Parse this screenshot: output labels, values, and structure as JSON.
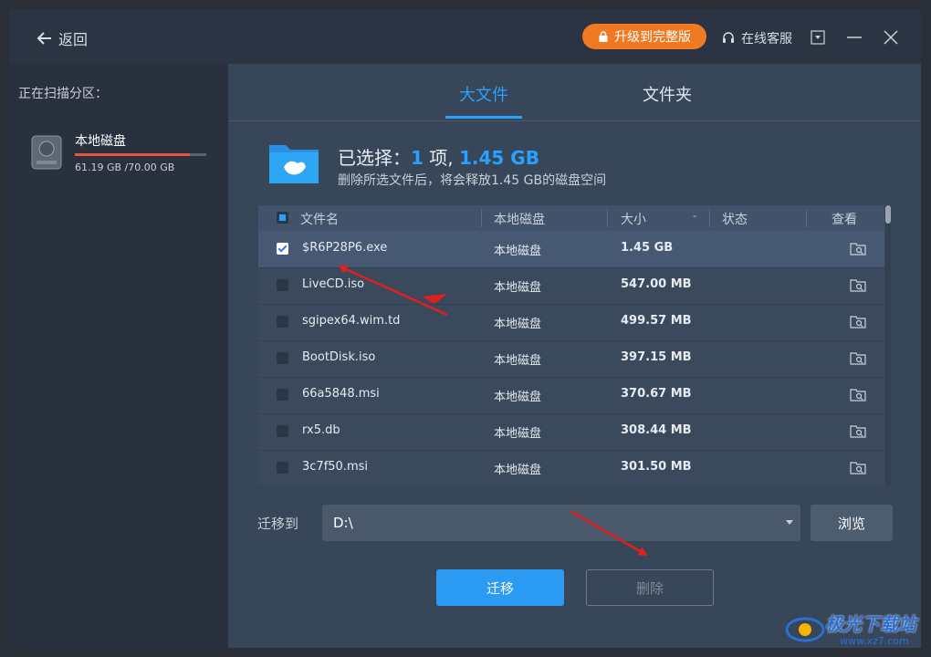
{
  "header": {
    "back_label": "返回",
    "upgrade_label": "升级到完整版",
    "support_label": "在线客服"
  },
  "sidebar": {
    "title": "正在扫描分区：",
    "disk": {
      "name": "本地磁盘",
      "size": "61.19 GB /70.00 GB",
      "used_fraction": 0.874
    }
  },
  "tabs": [
    {
      "label": "大文件",
      "active": true
    },
    {
      "label": "文件夹",
      "active": false
    }
  ],
  "summary": {
    "prefix": "已选择：",
    "count": "1",
    "count_unit": "项,",
    "size": "1.45 GB",
    "note": "删除所选文件后，将会释放1.45 GB的磁盘空间"
  },
  "table": {
    "headers": {
      "name": "文件名",
      "location": "本地磁盘",
      "size": "大小",
      "size_sort": "-",
      "status": "状态",
      "view": "查看"
    },
    "rows": [
      {
        "checked": true,
        "name": "$R6P28P6.exe",
        "location": "本地磁盘",
        "size": "1.45 GB",
        "status": ""
      },
      {
        "checked": false,
        "name": "LiveCD.iso",
        "location": "本地磁盘",
        "size": "547.00 MB",
        "status": ""
      },
      {
        "checked": false,
        "name": "sgipex64.wim.td",
        "location": "本地磁盘",
        "size": "499.57 MB",
        "status": ""
      },
      {
        "checked": false,
        "name": "BootDisk.iso",
        "location": "本地磁盘",
        "size": "397.15 MB",
        "status": ""
      },
      {
        "checked": false,
        "name": "66a5848.msi",
        "location": "本地磁盘",
        "size": "370.67 MB",
        "status": ""
      },
      {
        "checked": false,
        "name": "rx5.db",
        "location": "本地磁盘",
        "size": "308.44 MB",
        "status": ""
      },
      {
        "checked": false,
        "name": "3c7f50.msi",
        "location": "本地磁盘",
        "size": "301.50 MB",
        "status": ""
      }
    ]
  },
  "migrate": {
    "label": "迁移到",
    "path": "D:\\",
    "browse_label": "浏览",
    "migrate_button": "迁移",
    "delete_button": "删除"
  },
  "watermark": {
    "text": "极光下载站",
    "url": "www.xz7.com"
  },
  "colors": {
    "accent": "#2aa1ff",
    "upgrade": "#f07a21",
    "annotation_arrow": "#e0201c"
  }
}
